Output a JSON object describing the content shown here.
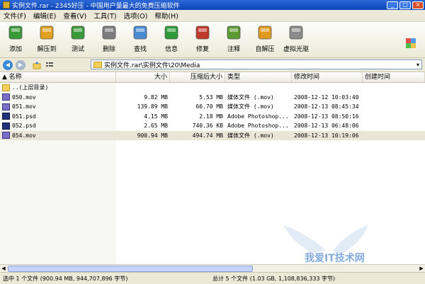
{
  "window": {
    "title": "实例文件.rar - 2345好压 - 中国用户量最大的免费压缩软件",
    "min": "_",
    "max": "□",
    "close": "×"
  },
  "menu": [
    "文件(F)",
    "编辑(E)",
    "查看(V)",
    "工具(T)",
    "选项(O)",
    "帮助(H)"
  ],
  "toolbar": [
    {
      "label": "添加",
      "icon": "add-archive-icon",
      "color": "#3a9a3a"
    },
    {
      "label": "解压到",
      "icon": "extract-to-icon",
      "color": "#e0a020"
    },
    {
      "label": "测试",
      "icon": "test-checklist-icon",
      "color": "#3a9a3a"
    },
    {
      "label": "删除",
      "icon": "trash-can-icon",
      "color": "#7d7d7d"
    },
    {
      "label": "查找",
      "icon": "magnifier-icon",
      "color": "#4a8ad0"
    },
    {
      "label": "信息",
      "icon": "info-icon",
      "color": "#2e9a3a"
    },
    {
      "label": "修复",
      "icon": "first-aid-kit-icon",
      "color": "#c0392b"
    },
    {
      "label": "注释",
      "icon": "notepad-pencil-icon",
      "color": "#5a9a30"
    },
    {
      "label": "自解压",
      "icon": "self-extract-icon",
      "color": "#e09a20"
    },
    {
      "label": "虚拟光驱",
      "icon": "virtual-drive-icon",
      "color": "#8a8a8a"
    }
  ],
  "address": {
    "path": "实例文件.rar\\实例文件\\20\\Media",
    "dropdown": "▾"
  },
  "columns": {
    "name": "名称",
    "size": "大小",
    "packed": "压缩后大小",
    "type": "类型",
    "modified": "修改时间",
    "created": "创建时间"
  },
  "rows": [
    {
      "name": "..(上层目录)",
      "icon": "folder-up-icon",
      "kind": "folder",
      "size": "",
      "packed": "",
      "type": "",
      "modified": "",
      "selected": false
    },
    {
      "name": "050.mov",
      "icon": "mov-file-icon",
      "kind": "mov",
      "size": "9.82 MB",
      "packed": "5.53 MB",
      "type": "媒体文件 (.mov)",
      "modified": "2008-12-12 10:03:40",
      "selected": false
    },
    {
      "name": "051.mov",
      "icon": "mov-file-icon",
      "kind": "mov",
      "size": "139.89 MB",
      "packed": "66.70 MB",
      "type": "媒体文件 (.mov)",
      "modified": "2008-12-13 08:45:34",
      "selected": false
    },
    {
      "name": "051.psd",
      "icon": "psd-file-icon",
      "kind": "psd",
      "size": "4.15 MB",
      "packed": "2.18 MB",
      "type": "Adobe Photoshop...",
      "modified": "2008-12-13 08:50:16",
      "selected": false
    },
    {
      "name": "052.psd",
      "icon": "psd-file-icon",
      "kind": "psd",
      "size": "2.65 MB",
      "packed": "740.36 KB",
      "type": "Adobe Photoshop...",
      "modified": "2008-12-13 06:48:06",
      "selected": false
    },
    {
      "name": "054.mov",
      "icon": "mov-file-icon",
      "kind": "mov",
      "size": "900.94 MB",
      "packed": "494.74 MB",
      "type": "媒体文件 (.mov)",
      "modified": "2008-12-13 10:19:06",
      "selected": true
    }
  ],
  "status": {
    "left": "选中 1 个文件 (900.94 MB, 944,707,896 字节)",
    "right": "总计 5 个文件 (1.03 GB, 1,108,836,333 字节)"
  },
  "watermark": {
    "text": "我爱IT技术网"
  },
  "colors": {
    "titlebar": "#0d45b8",
    "chrome": "#ece9d8",
    "selection": "#e9e6d8"
  }
}
